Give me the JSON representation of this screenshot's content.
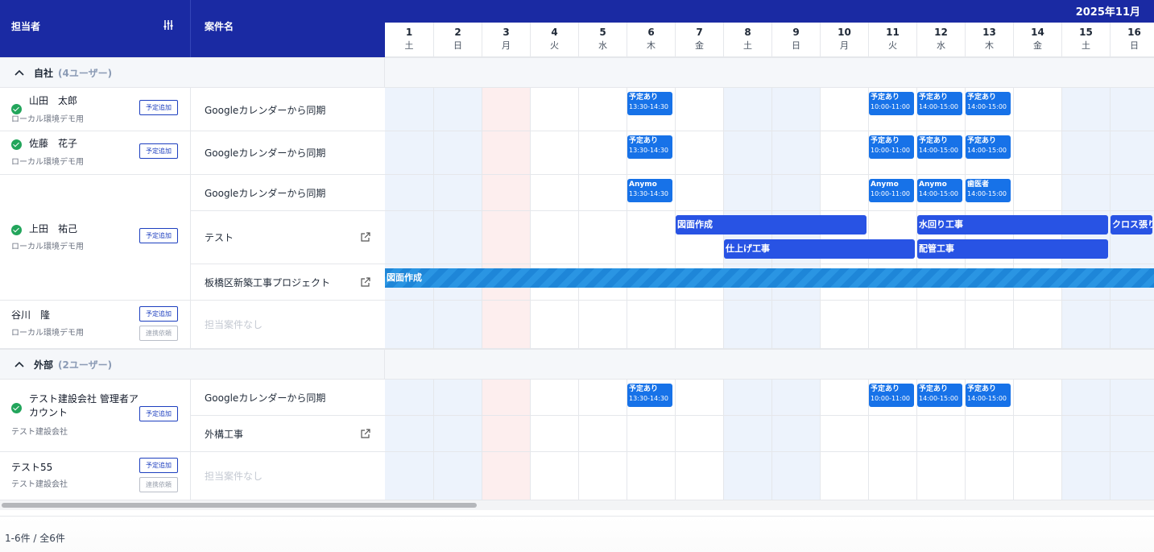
{
  "header": {
    "assignee_label": "担当者",
    "project_label": "案件名",
    "month_label": "2025年11月",
    "filter_icon": "sliders-icon"
  },
  "days": [
    {
      "num": "1",
      "wd": "土",
      "type": "weekend"
    },
    {
      "num": "2",
      "wd": "日",
      "type": "weekend"
    },
    {
      "num": "3",
      "wd": "月",
      "type": "holiday"
    },
    {
      "num": "4",
      "wd": "火",
      "type": "weekday"
    },
    {
      "num": "5",
      "wd": "水",
      "type": "weekday"
    },
    {
      "num": "6",
      "wd": "木",
      "type": "weekday"
    },
    {
      "num": "7",
      "wd": "金",
      "type": "weekday"
    },
    {
      "num": "8",
      "wd": "土",
      "type": "weekend"
    },
    {
      "num": "9",
      "wd": "日",
      "type": "weekend"
    },
    {
      "num": "10",
      "wd": "月",
      "type": "weekday"
    },
    {
      "num": "11",
      "wd": "火",
      "type": "weekday"
    },
    {
      "num": "12",
      "wd": "水",
      "type": "weekday"
    },
    {
      "num": "13",
      "wd": "木",
      "type": "weekday"
    },
    {
      "num": "14",
      "wd": "金",
      "type": "weekday"
    },
    {
      "num": "15",
      "wd": "土",
      "type": "weekend"
    },
    {
      "num": "16",
      "wd": "日",
      "type": "weekend"
    }
  ],
  "groups": [
    {
      "name": "自社",
      "count": "(4ユーザー)"
    },
    {
      "name": "外部",
      "count": "(2ユーザー)"
    }
  ],
  "users": [
    {
      "name": "山田　太郎",
      "sub": "ローカル環境デモ用",
      "add": "予定追加"
    },
    {
      "name": "佐藤　花子",
      "sub": "ローカル環境デモ用",
      "add": "予定追加"
    },
    {
      "name": "上田　祐己",
      "sub": "ローカル環境デモ用",
      "add": "予定追加"
    },
    {
      "name": "谷川　隆",
      "sub": "ローカル環境デモ用",
      "add": "予定追加",
      "link": "連携依頼"
    },
    {
      "name": "テスト建設会社 管理者アカウント",
      "sub": "テスト建設会社",
      "add": "予定追加"
    },
    {
      "name": "テスト55",
      "sub": "テスト建設会社",
      "add": "予定追加",
      "link": "連携依頼"
    }
  ],
  "projects": {
    "google_sync": "Googleカレンダーから同期",
    "test": "テスト",
    "itabashi": "板橋区新築工事プロジェクト",
    "none": "担当案件なし",
    "gaiko": "外構工事"
  },
  "events": {
    "yotei": "予定あり",
    "anymo": "Anymo",
    "shika": "歯医者",
    "t1330": "13:30-14:30",
    "t1000": "10:00-11:00",
    "t1400": "14:00-15:00"
  },
  "bars": {
    "zumen": "図面作成",
    "mizumawari": "水回り工事",
    "cross": "クロス張り",
    "shiage": "仕上げ工事",
    "haikan": "配管工事",
    "zumen2": "図面作成"
  },
  "footer": {
    "count": "1-6件 / 全6件"
  },
  "colors": {
    "header": "#1a2aa3",
    "event": "#1772e8",
    "bar": "#2853e4",
    "weekend": "#edf3fc",
    "holiday": "#fdeeee",
    "check": "#22a55b"
  }
}
